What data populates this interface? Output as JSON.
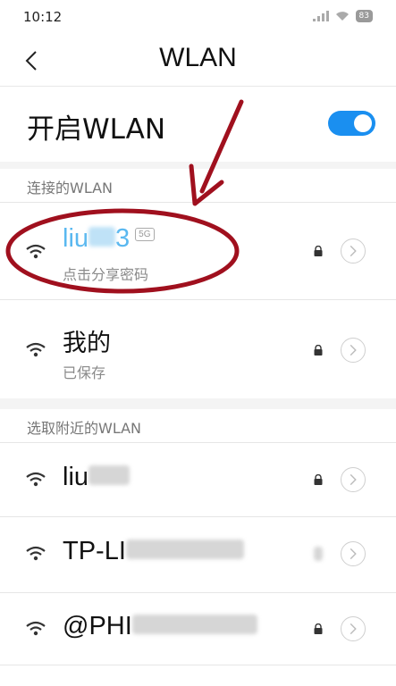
{
  "status": {
    "time": "10:12",
    "battery": "83"
  },
  "header": {
    "title": "WLAN"
  },
  "wlan_toggle": {
    "label": "开启WLAN",
    "state": "on"
  },
  "connected_section": {
    "header": "连接的WLAN",
    "networks": [
      {
        "name_visible": "liu",
        "name_suffix": "3",
        "band_badge": "5G",
        "subtitle": "点击分享密码"
      },
      {
        "name": "我的",
        "subtitle": "已保存"
      }
    ]
  },
  "nearby_section": {
    "header": "选取附近的WLAN",
    "networks": [
      {
        "name_visible": "liu"
      },
      {
        "name_visible": "TP-LI"
      },
      {
        "name_visible": "@PHI"
      }
    ]
  },
  "colors": {
    "accent": "#1a8ff0",
    "annotation": "#a0101e"
  },
  "icons": [
    "back-arrow-icon",
    "wifi-icon",
    "lock-icon",
    "chevron-right-icon",
    "signal-icon",
    "battery-icon"
  ]
}
